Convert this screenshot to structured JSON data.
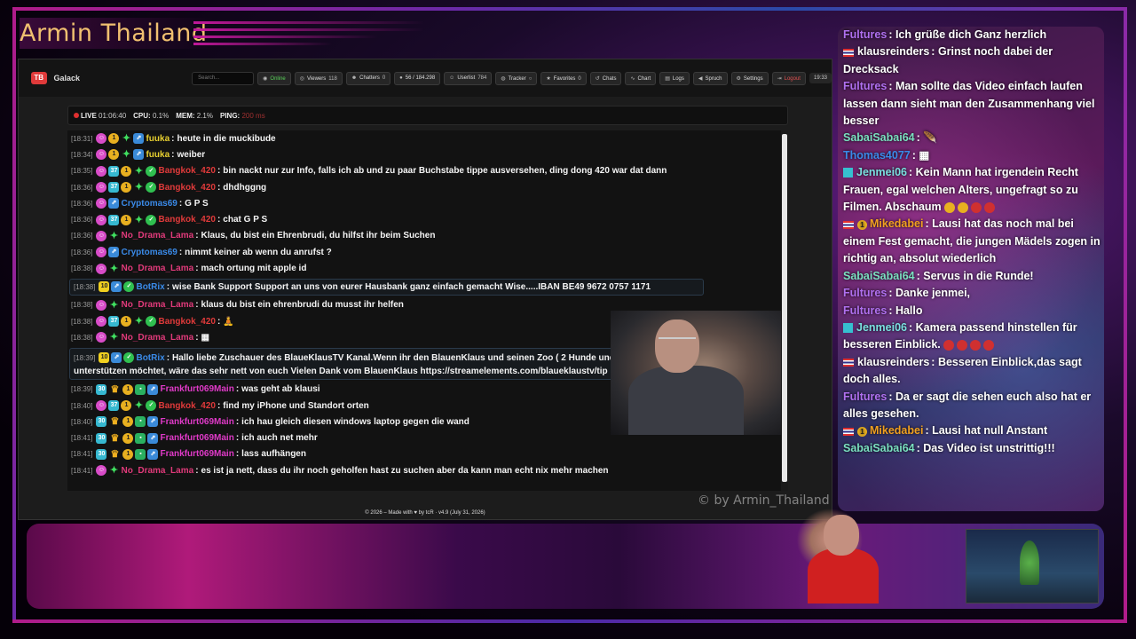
{
  "stream": {
    "title": "Armin Thailand",
    "watermark": "© by Armin_Thailand"
  },
  "site": {
    "logo": "TB",
    "brand": "Galack",
    "search_placeholder": "Search...",
    "nav": {
      "online": "Online",
      "viewers_label": "Viewers",
      "viewers_count": "118",
      "chatters_label": "Chatters",
      "chatters_count": "0",
      "messages": "56 / 184.298",
      "userlist_label": "Userlist",
      "userlist_count": "784",
      "tracker": "Tracker",
      "favorites_label": "Favorites",
      "favorites_count": "0",
      "chats": "Chats",
      "chart": "Chart",
      "logs": "Logs",
      "spruch": "Spruch",
      "settings": "Settings",
      "logout": "Logout",
      "clock": "19:33"
    },
    "status": {
      "live_label": "LIVE",
      "live_time": "01:06:40",
      "cpu_label": "CPU:",
      "cpu_val": "0.1%",
      "mem_label": "MEM:",
      "mem_val": "2.1%",
      "ping_label": "PING:",
      "ping_val": "200 ms"
    },
    "footer": "© 2026 – Made with ♥ by tcR · v4.9 (July 31, 2026)",
    "colors": {
      "accent_online": "#58d058",
      "logout": "#e05050",
      "live_dot": "#e03030"
    }
  },
  "chat": [
    {
      "ts": "[18:31]",
      "user": "fuuka",
      "color": "#e8d030",
      "msg": "heute in die muckibude",
      "badges": "pink,gold,green,blue"
    },
    {
      "ts": "[18:34]",
      "user": "fuuka",
      "color": "#e8d030",
      "msg": "weiber",
      "badges": "pink,gold,green,blue"
    },
    {
      "ts": "[18:35]",
      "user": "Bangkok_420",
      "color": "#e03a3a",
      "msg": "bin nackt nur zur Info, falls ich ab und zu paar Buchstabe tippe ausversehen, ding dong 420 war dat dann",
      "badges": "pink,cyan,gold,green,check"
    },
    {
      "ts": "[18:36]",
      "user": "Bangkok_420",
      "color": "#e03a3a",
      "msg": "dhdhggng",
      "badges": "pink,cyan,gold,green,check"
    },
    {
      "ts": "[18:36]",
      "user": "Cryptomas69",
      "color": "#3a8ae8",
      "msg": "G P S",
      "badges": "pink,blue"
    },
    {
      "ts": "[18:36]",
      "user": "Bangkok_420",
      "color": "#e03a3a",
      "msg": "chat G P S",
      "badges": "pink,cyan,gold,green,check"
    },
    {
      "ts": "[18:36]",
      "user": "No_Drama_Lama",
      "color": "#e03a7a",
      "msg": "Klaus, du bist ein Ehrenbrudi, du hilfst ihr beim Suchen",
      "badges": "pink,green"
    },
    {
      "ts": "[18:36]",
      "user": "Cryptomas69",
      "color": "#3a8ae8",
      "msg": "nimmt keiner ab wenn du anrufst ?",
      "badges": "pink,blue"
    },
    {
      "ts": "[18:38]",
      "user": "No_Drama_Lama",
      "color": "#e03a7a",
      "msg": "mach ortung mit apple id",
      "badges": "pink,green"
    },
    {
      "ts": "[18:38]",
      "user": "BotRix",
      "color": "#3a8ae8",
      "msg": "wise Bank Support Support an uns von eurer Hausbank ganz einfach gemacht Wise.....IBAN BE49 9672 0757 1171",
      "badges": "yellow,blue,check",
      "bot": true
    },
    {
      "ts": "[18:38]",
      "user": "No_Drama_Lama",
      "color": "#e03a7a",
      "msg": "klaus du bist ein ehrenbrudi du musst ihr helfen",
      "badges": "pink,green"
    },
    {
      "ts": "[18:38]",
      "user": "Bangkok_420",
      "color": "#e03a3a",
      "msg": "🧘",
      "badges": "pink,cyan,gold,green,check"
    },
    {
      "ts": "[18:38]",
      "user": "No_Drama_Lama",
      "color": "#e03a7a",
      "msg": "▦",
      "badges": "pink,green"
    },
    {
      "ts": "[18:39]",
      "user": "BotRix",
      "color": "#3a8ae8",
      "msg": "Hallo liebe Zuschauer des BlaueKlausTV Kanal.Wenn ihr den BlauenKlaus und seinen Zoo ( 2 Hunde und 1 Katze Mietzi ist auf Urlaub ) unterstützen möchtet, wäre das sehr nett von euch Vielen Dank vom BlauenKlaus https://streamelements.com/blaueklaustv/tip",
      "badges": "yellow,blue,check",
      "bot": true,
      "multi": true
    },
    {
      "ts": "[18:39]",
      "user": "Frankfurt069Main",
      "color": "#e03ac8",
      "msg": "was geht ab klausi",
      "badges": "cyan,crown,gold,mod,blue"
    },
    {
      "ts": "[18:40]",
      "user": "Bangkok_420",
      "color": "#e03a3a",
      "msg": "find my iPhone und Standort orten",
      "badges": "pink,cyan,gold,green,check"
    },
    {
      "ts": "[18:40]",
      "user": "Frankfurt069Main",
      "color": "#e03ac8",
      "msg": "ich hau gleich diesen windows laptop gegen die wand",
      "badges": "cyan,crown,gold,mod,blue"
    },
    {
      "ts": "[18:41]",
      "user": "Frankfurt069Main",
      "color": "#e03ac8",
      "msg": "ich auch net mehr",
      "badges": "cyan,crown,gold,mod,blue"
    },
    {
      "ts": "[18:41]",
      "user": "Frankfurt069Main",
      "color": "#e03ac8",
      "msg": "lass aufhängen",
      "badges": "cyan,crown,gold,mod,blue"
    },
    {
      "ts": "[18:41]",
      "user": "No_Drama_Lama",
      "color": "#e03a7a",
      "msg": "es ist ja nett, dass du ihr noch geholfen hast zu suchen aber da kann man echt nix mehr machen",
      "badges": "pink,green"
    }
  ],
  "side_chat": [
    {
      "user": "Fultures",
      "color": "#b070f0",
      "msg": "Ich grüße dich Ganz herzlich",
      "pre": ""
    },
    {
      "user": "klausreinders",
      "color": "#ffffff",
      "msg": "Grinst noch dabei der Drecksack",
      "pre": "flag"
    },
    {
      "user": "Fultures",
      "color": "#b070f0",
      "msg": "Man sollte das Video einfach laufen lassen dann sieht man den Zusammenhang viel besser",
      "pre": ""
    },
    {
      "user": "SabaiSabai64",
      "color": "#7ae0c0",
      "msg": "🪶",
      "pre": ""
    },
    {
      "user": "Thomas4077",
      "color": "#3a8ae8",
      "msg": "▦",
      "pre": ""
    },
    {
      "user": "Jenmei06",
      "color": "#7ae0e0",
      "msg": "Kein Mann hat irgendein Recht Frauen, egal welchen Alters, ungefragt so zu Filmen. Abschaum",
      "pre": "tw",
      "emos": "y,y,r,r"
    },
    {
      "user": "Mikedabei",
      "color": "#f0a020",
      "msg": "Lausi hat das noch mal bei einem Fest gemacht, die jungen Mädels zogen in richtig an, absolut wiederlich",
      "pre": "flagcoin"
    },
    {
      "user": "SabaiSabai64",
      "color": "#7ae0c0",
      "msg": "Servus in die Runde!",
      "pre": ""
    },
    {
      "user": "Fultures",
      "color": "#b070f0",
      "msg": "Danke jenmei,",
      "pre": ""
    },
    {
      "user": "Fultures",
      "color": "#b070f0",
      "msg": "Hallo",
      "pre": ""
    },
    {
      "user": "Jenmei06",
      "color": "#7ae0e0",
      "msg": "Kamera passend hinstellen für besseren Einblick.",
      "pre": "tw",
      "emos": "r,r,r,r"
    },
    {
      "user": "klausreinders",
      "color": "#ffffff",
      "msg": "Besseren Einblick,das sagt doch alles.",
      "pre": "flag"
    },
    {
      "user": "Fultures",
      "color": "#b070f0",
      "msg": "Da er sagt die sehen euch also hat er alles gesehen.",
      "pre": ""
    },
    {
      "user": "Mikedabei",
      "color": "#f0a020",
      "msg": "Lausi hat null Anstant",
      "pre": "flagcoin"
    },
    {
      "user": "SabaiSabai64",
      "color": "#7ae0c0",
      "msg": "Das Video ist unstrittig!!!",
      "pre": ""
    }
  ]
}
